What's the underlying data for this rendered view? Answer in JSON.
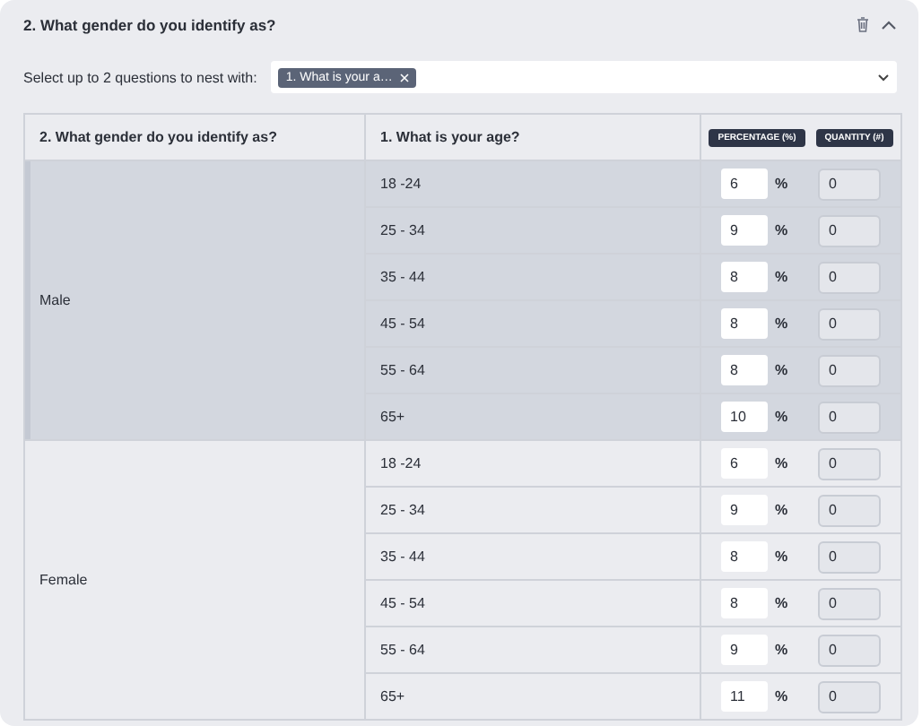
{
  "section": {
    "title": "2. What gender do you identify as?"
  },
  "nest": {
    "label": "Select up to 2 questions to nest with:",
    "chips": [
      "1. What is your a…"
    ]
  },
  "table": {
    "columns": [
      "2. What gender do you identify as?",
      "1. What is your age?"
    ],
    "badges": [
      "PERCENTAGE (%)",
      "QUANTITY (#)"
    ],
    "groups": [
      {
        "label": "Male",
        "highlighted": true,
        "rows": [
          {
            "age": "18 -24",
            "percentage": "6",
            "unit": "%",
            "quantity": "0",
            "quantity_disabled": true
          },
          {
            "age": "25 - 34",
            "percentage": "9",
            "unit": "%",
            "quantity": "0",
            "quantity_disabled": true
          },
          {
            "age": "35 - 44",
            "percentage": "8",
            "unit": "%",
            "quantity": "0",
            "quantity_disabled": true
          },
          {
            "age": "45 - 54",
            "percentage": "8",
            "unit": "%",
            "quantity": "0",
            "quantity_disabled": true
          },
          {
            "age": "55 - 64",
            "percentage": "8",
            "unit": "%",
            "quantity": "0",
            "quantity_disabled": true
          },
          {
            "age": "65+",
            "percentage": "10",
            "unit": "%",
            "quantity": "0",
            "quantity_disabled": true
          }
        ]
      },
      {
        "label": "Female",
        "highlighted": false,
        "rows": [
          {
            "age": "18 -24",
            "percentage": "6",
            "unit": "%",
            "quantity": "0",
            "quantity_disabled": true
          },
          {
            "age": "25 - 34",
            "percentage": "9",
            "unit": "%",
            "quantity": "0",
            "quantity_disabled": true
          },
          {
            "age": "35 - 44",
            "percentage": "8",
            "unit": "%",
            "quantity": "0",
            "quantity_disabled": true
          },
          {
            "age": "45 - 54",
            "percentage": "8",
            "unit": "%",
            "quantity": "0",
            "quantity_disabled": true
          },
          {
            "age": "55 - 64",
            "percentage": "9",
            "unit": "%",
            "quantity": "0",
            "quantity_disabled": true
          },
          {
            "age": "65+",
            "percentage": "11",
            "unit": "%",
            "quantity": "0",
            "quantity_disabled": true
          }
        ]
      }
    ]
  }
}
